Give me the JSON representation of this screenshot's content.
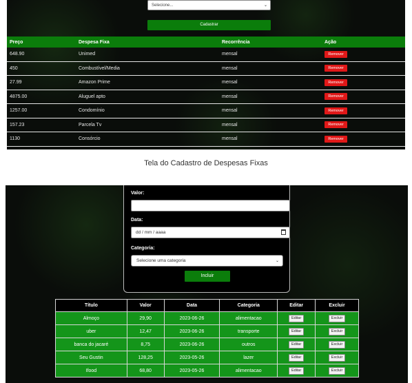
{
  "fixed_expenses_screen": {
    "select_placeholder": "Selecione...",
    "submit_label": "Cadastrar",
    "columns": [
      "Preço",
      "Despesa Fixa",
      "Recorrência",
      "Ação"
    ],
    "rows": [
      {
        "preco": "648.90",
        "despesa": "Unimed",
        "recorrencia": "mensal",
        "acao": "Remover"
      },
      {
        "preco": "450",
        "despesa": "Combustível/Media",
        "recorrencia": "mensal",
        "acao": "Remover"
      },
      {
        "preco": "27.99",
        "despesa": "Amazon Prime",
        "recorrencia": "mensal",
        "acao": "Remover"
      },
      {
        "preco": "4875.00",
        "despesa": "Aluguel apto",
        "recorrencia": "mensal",
        "acao": "Remover"
      },
      {
        "preco": "1257.00",
        "despesa": "Condomínio",
        "recorrencia": "mensal",
        "acao": "Remover"
      },
      {
        "preco": "157.23",
        "despesa": "Parcela Tv",
        "recorrencia": "mensal",
        "acao": "Remover"
      },
      {
        "preco": "1130",
        "despesa": "Consórcio",
        "recorrencia": "mensal",
        "acao": "Remover"
      }
    ]
  },
  "caption": "Tela do Cadastro de Despesas Fixas",
  "expenses_screen": {
    "valor_label": "Valor:",
    "valor_value": "",
    "data_label": "Data:",
    "data_placeholder": "dd / mm / aaaa",
    "categoria_label": "Categoria:",
    "categoria_placeholder": "Selecione uma categoria",
    "submit_label": "Incluir",
    "columns": [
      "Título",
      "Valor",
      "Data",
      "Categoria",
      "Editar",
      "Excluir"
    ],
    "edit_label": "Editar",
    "delete_label": "Excluir",
    "rows": [
      {
        "titulo": "Almoço",
        "valor": "29,90",
        "data": "2023-06-26",
        "categoria": "alimentacao"
      },
      {
        "titulo": "uber",
        "valor": "12,47",
        "data": "2023-06-26",
        "categoria": "transporte"
      },
      {
        "titulo": "banca do jacaré",
        "valor": "8,75",
        "data": "2023-06-26",
        "categoria": "outros"
      },
      {
        "titulo": "Seu Gustin",
        "valor": "128,25",
        "data": "2023-05-26",
        "categoria": "lazer"
      },
      {
        "titulo": "Ifood",
        "valor": "68,80",
        "data": "2023-05-26",
        "categoria": "alimentacao"
      }
    ]
  },
  "colors": {
    "accent_green": "#0b7d0b",
    "row_green": "#14951a",
    "remove_red": "#e01818",
    "background_dark": "#0a0d0a"
  }
}
